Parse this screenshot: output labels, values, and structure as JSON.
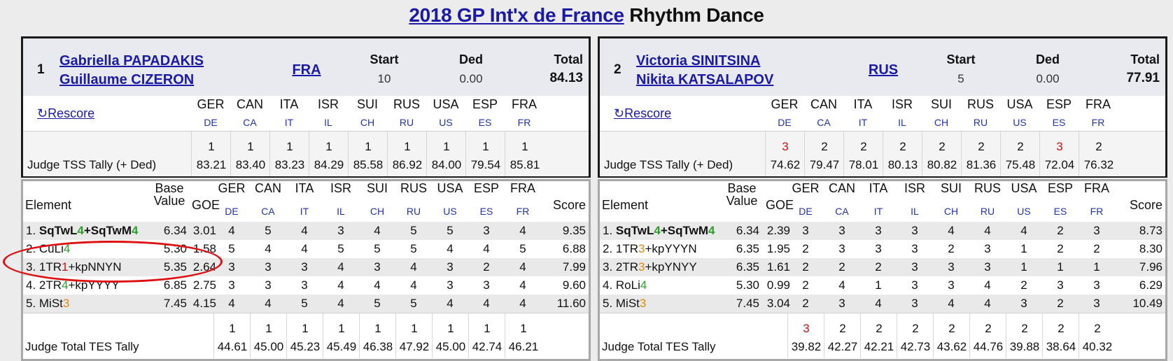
{
  "page_title": {
    "link": "2018 GP Int'x de France",
    "rest": "Rhythm Dance"
  },
  "labels": {
    "start": "Start",
    "ded": "Ded",
    "total": "Total",
    "rescore": "Rescore",
    "judge_tss": "Judge TSS Tally (+ Ded)",
    "element": "Element",
    "base": "Base",
    "value": "Value",
    "goe": "GOE",
    "score": "Score",
    "judge_tes": "Judge Total TES Tally"
  },
  "judges": [
    {
      "name": "GER",
      "code": "DE"
    },
    {
      "name": "CAN",
      "code": "CA"
    },
    {
      "name": "ITA",
      "code": "IT"
    },
    {
      "name": "ISR",
      "code": "IL"
    },
    {
      "name": "SUI",
      "code": "CH"
    },
    {
      "name": "RUS",
      "code": "RU"
    },
    {
      "name": "USA",
      "code": "US"
    },
    {
      "name": "ESP",
      "code": "ES"
    },
    {
      "name": "FRA",
      "code": "FR"
    }
  ],
  "teams": [
    {
      "rank": "1",
      "name1": "Gabriella PAPADAKIS",
      "name2": "Guillaume CIZERON",
      "nation": "FRA",
      "start": "10",
      "ded": "0.00",
      "total": "84.13",
      "tss": [
        [
          "1",
          "83.21"
        ],
        [
          "1",
          "83.40"
        ],
        [
          "1",
          "83.23"
        ],
        [
          "1",
          "84.29"
        ],
        [
          "1",
          "85.58"
        ],
        [
          "1",
          "86.92"
        ],
        [
          "1",
          "84.00"
        ],
        [
          "1",
          "79.54"
        ],
        [
          "1",
          "85.81"
        ]
      ],
      "tss_red": [
        false,
        false,
        false,
        false,
        false,
        false,
        false,
        false,
        false
      ],
      "elements": [
        {
          "parts": [
            [
              "1. ",
              ""
            ],
            [
              "SqTwL",
              "b"
            ],
            [
              "4",
              "bg"
            ],
            [
              "+SqTwM",
              "b"
            ],
            [
              "4",
              "bg"
            ]
          ],
          "base": "6.34",
          "goe": "3.01",
          "marks": [
            "4",
            "5",
            "4",
            "3",
            "4",
            "5",
            "5",
            "3",
            "4"
          ],
          "score": "9.35"
        },
        {
          "parts": [
            [
              "2. CuLi",
              ""
            ],
            [
              "4",
              "g"
            ]
          ],
          "base": "5.30",
          "goe": "1.58",
          "marks": [
            "5",
            "4",
            "4",
            "5",
            "5",
            "5",
            "4",
            "4",
            "5"
          ],
          "score": "6.88"
        },
        {
          "parts": [
            [
              "3. 1TR",
              ""
            ],
            [
              "1",
              "r"
            ],
            [
              "+kpNNYN",
              ""
            ]
          ],
          "base": "5.35",
          "goe": "2.64",
          "marks": [
            "3",
            "3",
            "3",
            "4",
            "3",
            "4",
            "3",
            "2",
            "4"
          ],
          "score": "7.99"
        },
        {
          "parts": [
            [
              "4. 2TR",
              ""
            ],
            [
              "4",
              "g"
            ],
            [
              "+kpYYYY",
              ""
            ]
          ],
          "base": "6.85",
          "goe": "2.75",
          "marks": [
            "3",
            "3",
            "3",
            "4",
            "4",
            "4",
            "3",
            "3",
            "4"
          ],
          "score": "9.60"
        },
        {
          "parts": [
            [
              "5. MiSt",
              ""
            ],
            [
              "3",
              "o"
            ]
          ],
          "base": "7.45",
          "goe": "4.15",
          "marks": [
            "4",
            "4",
            "5",
            "4",
            "5",
            "5",
            "4",
            "4",
            "4"
          ],
          "score": "11.60"
        }
      ],
      "tes": [
        [
          "1",
          "44.61"
        ],
        [
          "1",
          "45.00"
        ],
        [
          "1",
          "45.23"
        ],
        [
          "1",
          "45.49"
        ],
        [
          "1",
          "46.38"
        ],
        [
          "1",
          "47.92"
        ],
        [
          "1",
          "45.00"
        ],
        [
          "1",
          "42.74"
        ],
        [
          "1",
          "46.21"
        ]
      ],
      "tes_red": [
        false,
        false,
        false,
        false,
        false,
        false,
        false,
        false,
        false
      ]
    },
    {
      "rank": "2",
      "name1": "Victoria SINITSINA",
      "name2": "Nikita KATSALAPOV",
      "nation": "RUS",
      "start": "5",
      "ded": "0.00",
      "total": "77.91",
      "tss": [
        [
          "3",
          "74.62"
        ],
        [
          "2",
          "79.47"
        ],
        [
          "2",
          "78.01"
        ],
        [
          "2",
          "80.13"
        ],
        [
          "2",
          "80.82"
        ],
        [
          "2",
          "81.36"
        ],
        [
          "2",
          "75.48"
        ],
        [
          "3",
          "72.04"
        ],
        [
          "2",
          "76.32"
        ]
      ],
      "tss_red": [
        true,
        false,
        false,
        false,
        false,
        false,
        false,
        true,
        false
      ],
      "elements": [
        {
          "parts": [
            [
              "1. ",
              ""
            ],
            [
              "SqTwL",
              "b"
            ],
            [
              "4",
              "bg"
            ],
            [
              "+SqTwM",
              "b"
            ],
            [
              "4",
              "bg"
            ]
          ],
          "base": "6.34",
          "goe": "2.39",
          "marks": [
            "3",
            "3",
            "3",
            "3",
            "4",
            "4",
            "4",
            "2",
            "3"
          ],
          "score": "8.73"
        },
        {
          "parts": [
            [
              "2. 1TR",
              ""
            ],
            [
              "3",
              "o"
            ],
            [
              "+kpYYYN",
              ""
            ]
          ],
          "base": "6.35",
          "goe": "1.95",
          "marks": [
            "2",
            "3",
            "3",
            "3",
            "2",
            "3",
            "1",
            "2",
            "2"
          ],
          "score": "8.30"
        },
        {
          "parts": [
            [
              "3. 2TR",
              ""
            ],
            [
              "3",
              "o"
            ],
            [
              "+kpYNYY",
              ""
            ]
          ],
          "base": "6.35",
          "goe": "1.61",
          "marks": [
            "2",
            "2",
            "2",
            "3",
            "3",
            "3",
            "1",
            "1",
            "1"
          ],
          "score": "7.96"
        },
        {
          "parts": [
            [
              "4. RoLi",
              ""
            ],
            [
              "4",
              "g"
            ]
          ],
          "base": "5.30",
          "goe": "0.99",
          "marks": [
            "2",
            "4",
            "1",
            "3",
            "3",
            "4",
            "2",
            "3",
            "3"
          ],
          "score": "6.29"
        },
        {
          "parts": [
            [
              "5. MiSt",
              ""
            ],
            [
              "3",
              "o"
            ]
          ],
          "base": "7.45",
          "goe": "3.04",
          "marks": [
            "2",
            "3",
            "4",
            "3",
            "4",
            "4",
            "3",
            "2",
            "3"
          ],
          "score": "10.49"
        }
      ],
      "tes": [
        [
          "3",
          "39.82"
        ],
        [
          "2",
          "42.27"
        ],
        [
          "2",
          "42.21"
        ],
        [
          "2",
          "42.73"
        ],
        [
          "2",
          "43.62"
        ],
        [
          "2",
          "44.76"
        ],
        [
          "2",
          "39.88"
        ],
        [
          "2",
          "38.64"
        ],
        [
          "2",
          "40.32"
        ]
      ],
      "tes_red": [
        true,
        false,
        false,
        false,
        false,
        false,
        false,
        false,
        false
      ]
    }
  ],
  "colors": {
    "link": "#1a1aa6",
    "code": "#2233aa",
    "green": "#2aa02a",
    "orange": "#e08a0a",
    "red": "#cc1111",
    "circle": "#dd1111"
  }
}
